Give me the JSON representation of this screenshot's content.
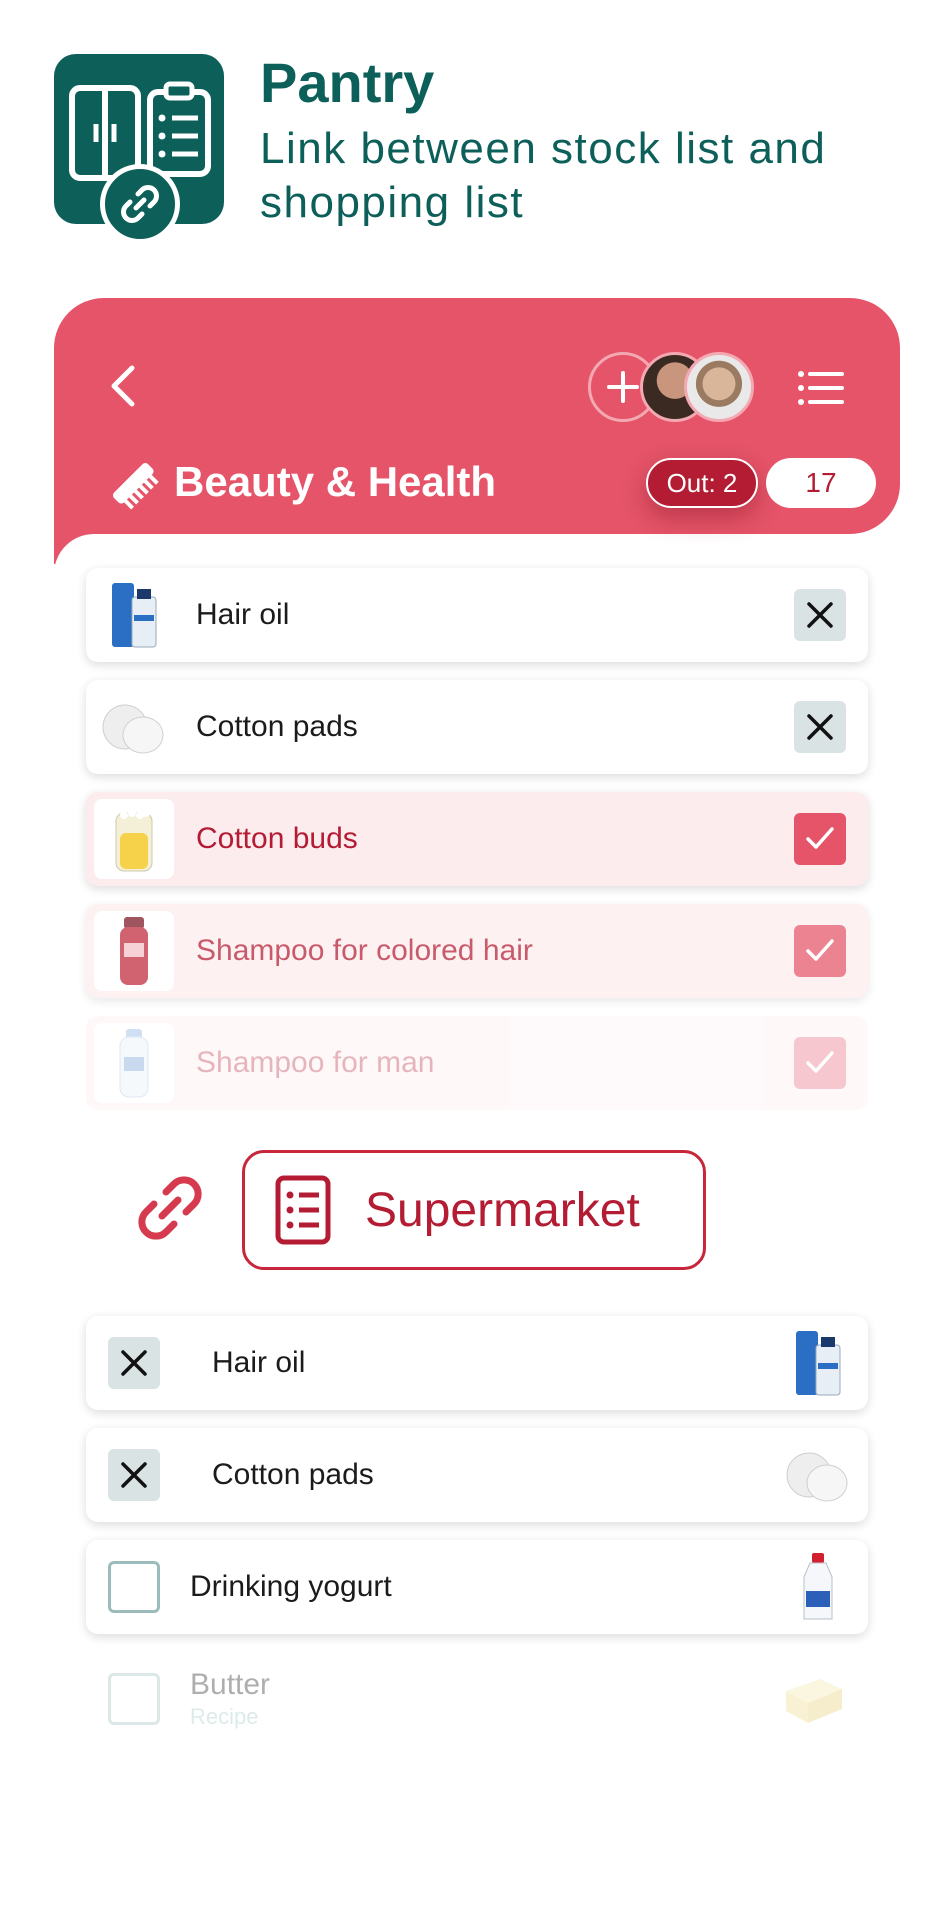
{
  "promo": {
    "title": "Pantry",
    "subtitle": "Link between stock list and shopping list"
  },
  "list_header": {
    "category_title": "Beauty & Health",
    "out_label": "Out: 2",
    "count": "17"
  },
  "stock_items": [
    {
      "label": "Hair oil",
      "state": "removed"
    },
    {
      "label": "Cotton pads",
      "state": "removed"
    },
    {
      "label": "Cotton buds",
      "state": "checked"
    },
    {
      "label": "Shampoo for colored hair",
      "state": "checked"
    },
    {
      "label": "Shampoo for man",
      "state": "checked"
    }
  ],
  "linked_list": {
    "label": "Supermarket"
  },
  "shopping_items": [
    {
      "label": "Hair oil",
      "state": "removed"
    },
    {
      "label": "Cotton pads",
      "state": "removed"
    },
    {
      "label": "Drinking yogurt",
      "state": "unchecked"
    },
    {
      "label": "Butter",
      "sublabel": "Recipe",
      "state": "unchecked"
    }
  ],
  "colors": {
    "brand_green": "#0d5f5a",
    "header_red": "#e55468",
    "accent_red": "#b41c33"
  },
  "icons": [
    "pantry-app-icon",
    "link-icon",
    "back-chevron-icon",
    "add-icon",
    "menu-list-icon",
    "comb-icon",
    "close-x-icon",
    "checkmark-icon",
    "shopping-list-icon"
  ]
}
